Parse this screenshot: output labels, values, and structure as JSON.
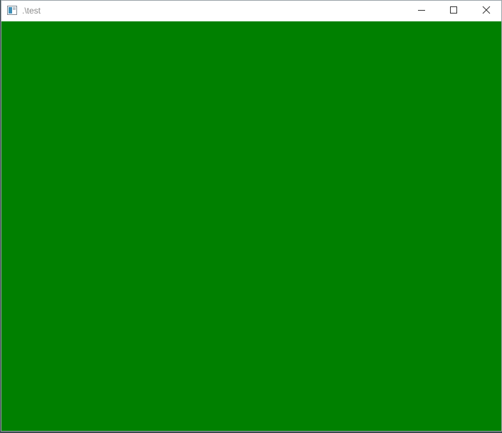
{
  "window": {
    "title": ".\\test"
  },
  "titlebar": {
    "icons": {
      "app": "app-window-icon",
      "minimize": "minimize-icon",
      "maximize": "maximize-icon",
      "close": "close-icon"
    }
  },
  "client": {
    "fill_color": "#008000"
  }
}
